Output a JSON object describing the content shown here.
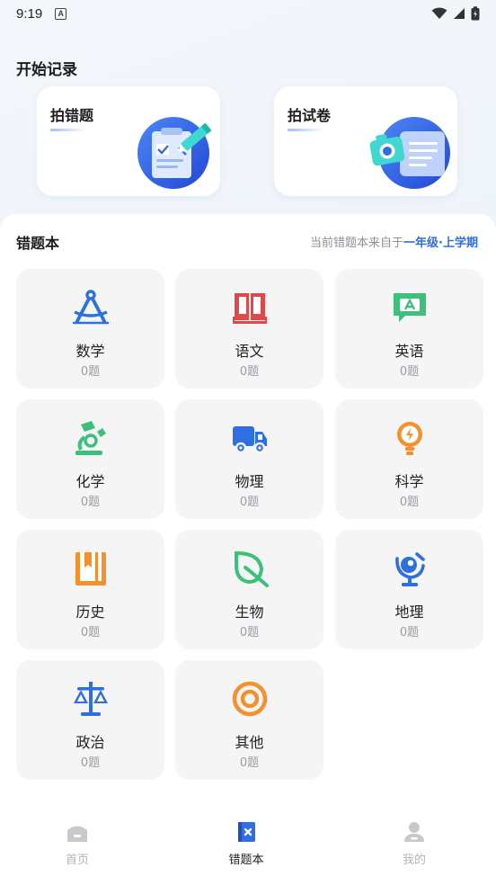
{
  "status_bar": {
    "time": "9:19",
    "notification_badge": "A"
  },
  "record_section": {
    "title": "开始记录",
    "cards": [
      {
        "label": "拍错题",
        "icon": "clipboard-pencil-illustration"
      },
      {
        "label": "拍试卷",
        "icon": "camera-paper-illustration"
      }
    ]
  },
  "mistake_book": {
    "title": "错题本",
    "source_prefix": "当前错题本来自于",
    "source_grade": "一年级·上学期",
    "subjects": [
      {
        "name": "数学",
        "count": "0题",
        "icon": "compass-icon",
        "color": "#2f6fe0"
      },
      {
        "name": "语文",
        "count": "0题",
        "icon": "book-icon",
        "color": "#e0484a"
      },
      {
        "name": "英语",
        "count": "0题",
        "icon": "chat-a-icon",
        "color": "#3ec07d"
      },
      {
        "name": "化学",
        "count": "0题",
        "icon": "microscope-icon",
        "color": "#3ec07d"
      },
      {
        "name": "物理",
        "count": "0题",
        "icon": "truck-icon",
        "color": "#2f6fe0"
      },
      {
        "name": "科学",
        "count": "0题",
        "icon": "bulb-icon",
        "color": "#f5902e"
      },
      {
        "name": "历史",
        "count": "0题",
        "icon": "bookmark-book-icon",
        "color": "#f5902e"
      },
      {
        "name": "生物",
        "count": "0题",
        "icon": "leaf-icon",
        "color": "#3ec07d"
      },
      {
        "name": "地理",
        "count": "0题",
        "icon": "globe-icon",
        "color": "#2f6fe0"
      },
      {
        "name": "政治",
        "count": "0题",
        "icon": "scale-icon",
        "color": "#2f6fe0"
      },
      {
        "name": "其他",
        "count": "0题",
        "icon": "target-icon",
        "color": "#f5902e"
      }
    ]
  },
  "tabbar": {
    "tabs": [
      {
        "label": "首页",
        "icon": "home-icon",
        "active": false
      },
      {
        "label": "错题本",
        "icon": "mistake-book-icon",
        "active": true
      },
      {
        "label": "我的",
        "icon": "profile-icon",
        "active": false
      }
    ]
  },
  "colors": {
    "accent": "#2f6fe0",
    "inactive": "#b3b5ba",
    "card_bg": "#f5f5f6"
  }
}
